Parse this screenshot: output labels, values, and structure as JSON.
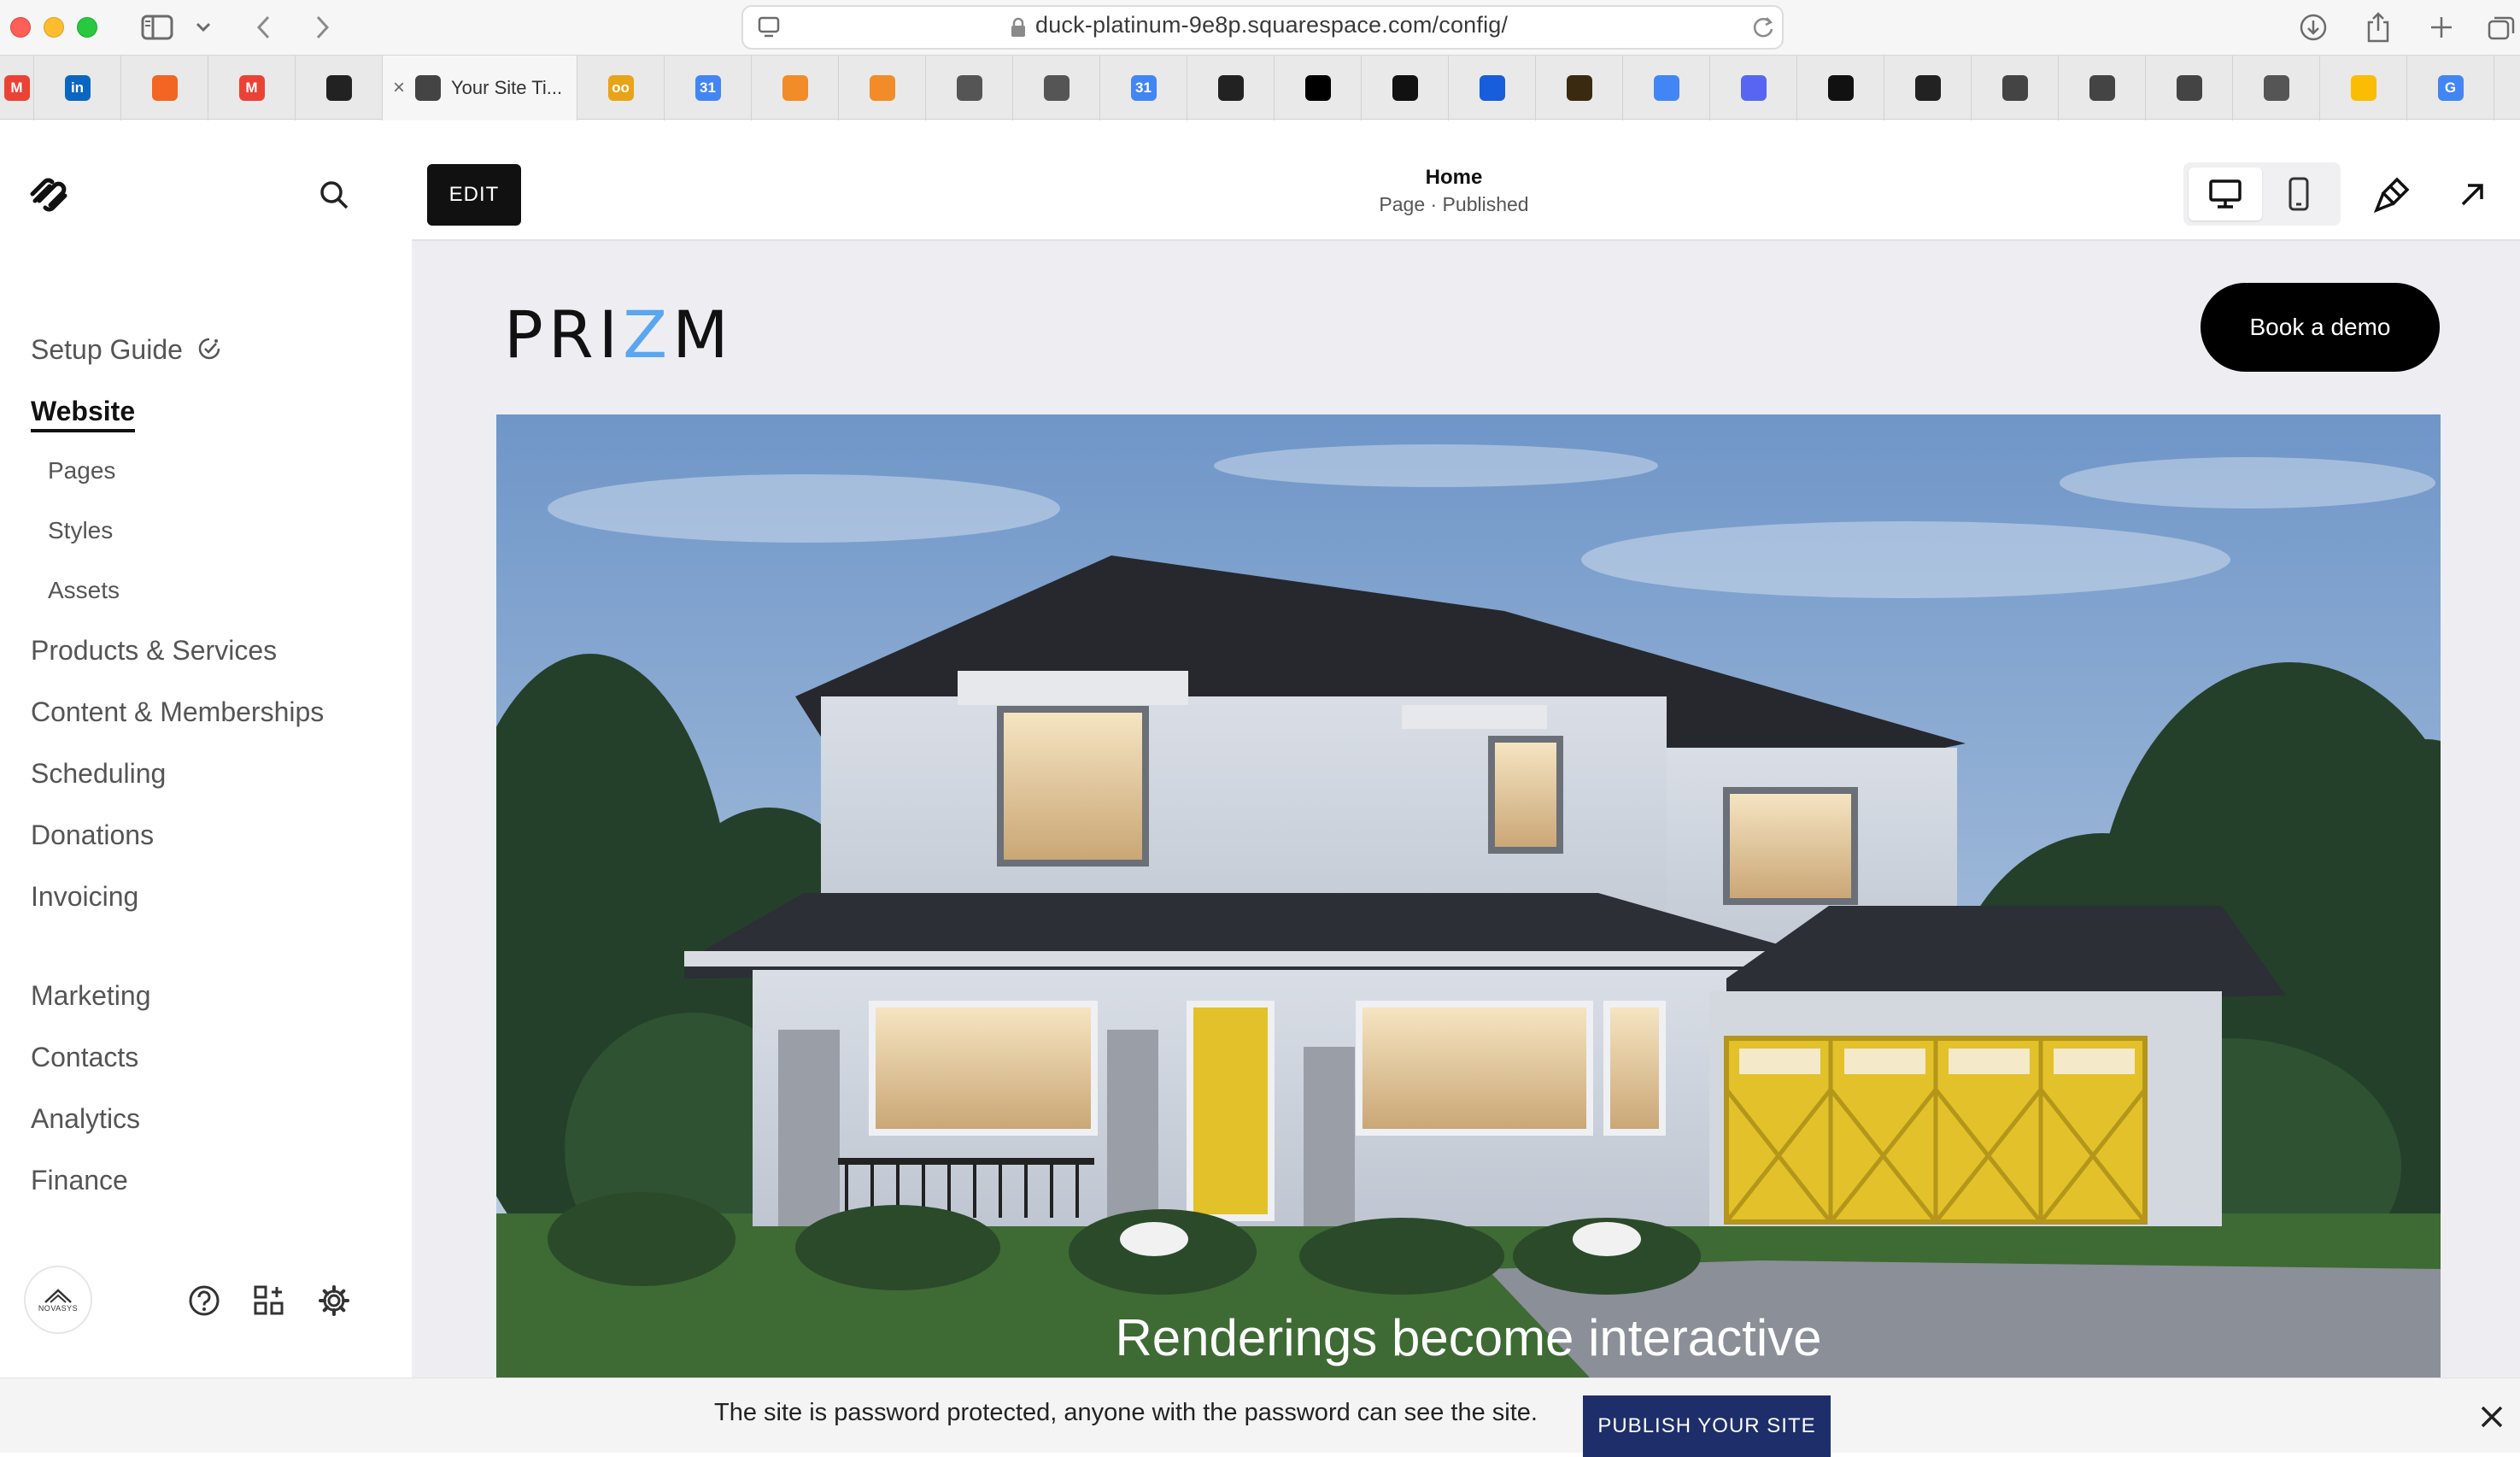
{
  "browser": {
    "url": "duck-platinum-9e8p.squarespace.com/config/",
    "active_tab_title": "Your Site Ti...",
    "tabs": [
      {
        "icon": "gmail-icon",
        "glyph": "M",
        "color": "#ea4335"
      },
      {
        "icon": "linkedin-icon",
        "glyph": "in",
        "color": "#0a66c2"
      },
      {
        "icon": "orange-circle-icon",
        "glyph": "",
        "color": "#f26522"
      },
      {
        "icon": "gmail-icon",
        "glyph": "M",
        "color": "#ea4335"
      },
      {
        "icon": "squarespace-icon",
        "glyph": "",
        "color": "#222222"
      },
      {
        "icon": "cube-icon",
        "glyph": "",
        "color": "#444444"
      },
      {
        "icon": "infinity-icon",
        "glyph": "oo",
        "color": "#e8a317"
      },
      {
        "icon": "calendar-icon",
        "glyph": "31",
        "color": "#4285f4"
      },
      {
        "icon": "orange-box-icon",
        "glyph": "",
        "color": "#f28c28"
      },
      {
        "icon": "orange-box-icon",
        "glyph": "",
        "color": "#f28c28"
      },
      {
        "icon": "roof-icon",
        "glyph": "",
        "color": "#555555"
      },
      {
        "icon": "roof-icon",
        "glyph": "",
        "color": "#555555"
      },
      {
        "icon": "calendar-icon",
        "glyph": "31",
        "color": "#4285f4"
      },
      {
        "icon": "openai-icon",
        "glyph": "",
        "color": "#222222"
      },
      {
        "icon": "openai-icon",
        "glyph": "",
        "color": "#000000"
      },
      {
        "icon": "puzzle-icon",
        "glyph": "",
        "color": "#111111"
      },
      {
        "icon": "bitwarden-icon",
        "glyph": "",
        "color": "#175ddc"
      },
      {
        "icon": "brand-icon",
        "glyph": "",
        "color": "#3a2a10"
      },
      {
        "icon": "docs-icon",
        "glyph": "",
        "color": "#4285f4"
      },
      {
        "icon": "discord-icon",
        "glyph": "",
        "color": "#5865f2"
      },
      {
        "icon": "squarespace-icon",
        "glyph": "",
        "color": "#111111"
      },
      {
        "icon": "squarespace-icon",
        "glyph": "",
        "color": "#222222"
      },
      {
        "icon": "cube-icon",
        "glyph": "",
        "color": "#444444"
      },
      {
        "icon": "cube-icon",
        "glyph": "",
        "color": "#444444"
      },
      {
        "icon": "cube-icon",
        "glyph": "",
        "color": "#444444"
      },
      {
        "icon": "roof-icon",
        "glyph": "",
        "color": "#555555"
      },
      {
        "icon": "drive-icon",
        "glyph": "",
        "color": "#fbbc04"
      },
      {
        "icon": "google-icon",
        "glyph": "G",
        "color": "#4285f4"
      }
    ]
  },
  "sidebar": {
    "nav": [
      {
        "label": "Setup Guide"
      },
      {
        "label": "Website"
      },
      {
        "label": "Products & Services"
      },
      {
        "label": "Content & Memberships"
      },
      {
        "label": "Scheduling"
      },
      {
        "label": "Donations"
      },
      {
        "label": "Invoicing"
      },
      {
        "label": "Marketing"
      },
      {
        "label": "Contacts"
      },
      {
        "label": "Analytics"
      },
      {
        "label": "Finance"
      }
    ],
    "website_sub": [
      {
        "label": "Pages"
      },
      {
        "label": "Styles"
      },
      {
        "label": "Assets"
      }
    ],
    "account_logo_text": "NOVASYS"
  },
  "editor": {
    "edit_label": "EDIT",
    "page_title": "Home",
    "page_status": "Page · Published"
  },
  "site": {
    "logo_prefix": "PRI",
    "logo_accent": "Z",
    "logo_suffix": "M",
    "logo_accent_color": "#5aa6f0",
    "cta_label": "Book a demo",
    "hero_caption": "Renderings become interactive"
  },
  "banner": {
    "text": "The site is password protected, anyone with the password can see the site.",
    "publish_label": "PUBLISH YOUR SITE",
    "publish_color": "#1d2e6a"
  }
}
